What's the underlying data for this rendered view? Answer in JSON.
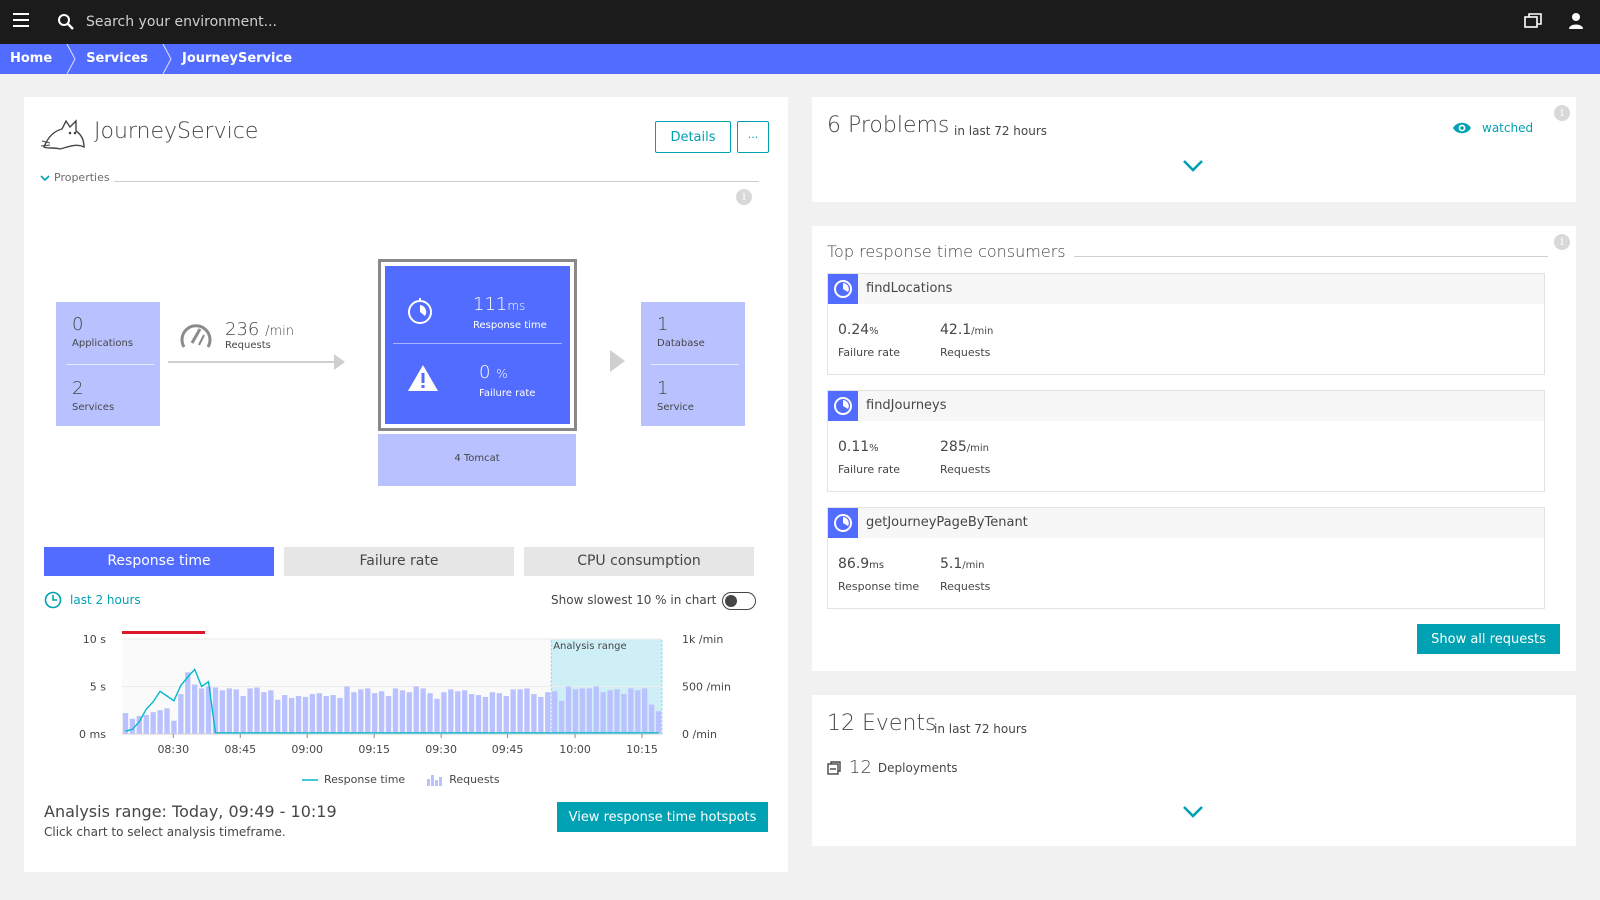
{
  "topbar": {
    "search_placeholder": "Search your environment..."
  },
  "breadcrumb": [
    "Home",
    "Services",
    "JourneyService"
  ],
  "service": {
    "name": "JourneyService",
    "details_label": "Details",
    "more_label": "···",
    "properties_label": "Properties"
  },
  "flow": {
    "callers": {
      "applications_value": "0",
      "applications_label": "Applications",
      "services_value": "2",
      "services_label": "Services"
    },
    "requests": {
      "value": "236",
      "unit": "/min",
      "label": "Requests"
    },
    "main": {
      "response_value": "111",
      "response_unit": "ms",
      "response_label": "Response time",
      "failure_value": "0",
      "failure_unit": "%",
      "failure_label": "Failure rate",
      "process_label": "4 Tomcat"
    },
    "callees": {
      "database_value": "1",
      "database_label": "Database",
      "service_value": "1",
      "service_label": "Service"
    }
  },
  "tabs": [
    "Response time",
    "Failure rate",
    "CPU consumption"
  ],
  "timeframe_label": "last 2 hours",
  "slowest_label": "Show slowest 10 % in chart",
  "chart_data": {
    "type": "bar",
    "x_ticks": [
      "08:30",
      "08:45",
      "09:00",
      "09:15",
      "09:30",
      "09:45",
      "10:00",
      "10:15"
    ],
    "y_left_ticks": [
      "10 s",
      "5 s",
      "0 ms"
    ],
    "y_right_ticks": [
      "1k /min",
      "500 /min",
      "0 /min"
    ],
    "analysis_range_label": "Analysis range",
    "ylim_left_s": [
      0,
      10
    ],
    "ylim_right_per_min": [
      0,
      1000
    ],
    "series": [
      {
        "name": "Requests",
        "values": [
          220,
          160,
          190,
          200,
          230,
          250,
          270,
          140,
          420,
          650,
          520,
          480,
          500,
          490,
          460,
          480,
          470,
          400,
          480,
          490,
          440,
          460,
          360,
          410,
          380,
          400,
          390,
          420,
          430,
          400,
          410,
          380,
          500,
          440,
          470,
          480,
          430,
          450,
          400,
          480,
          460,
          440,
          500,
          480,
          430,
          370,
          440,
          470,
          450,
          460,
          420,
          410,
          390,
          440,
          430,
          400,
          470,
          470,
          480,
          420,
          390,
          440,
          450,
          350,
          500,
          470,
          480,
          480,
          500,
          440,
          460,
          470,
          420,
          480,
          460,
          480,
          310,
          240
        ]
      },
      {
        "name": "Response time",
        "values": [
          0.3,
          0.5,
          1.3,
          2.6,
          3.4,
          4.5,
          4.0,
          3.5,
          5.1,
          6.0,
          6.8,
          5.0,
          5.5,
          0.1,
          0.1,
          0.1,
          0.1,
          0.1,
          0.1,
          0.1,
          0.1,
          0.1,
          0.1,
          0.1,
          0.1,
          0.1,
          0.1,
          0.1,
          0.1,
          0.1,
          0.1,
          0.1,
          0.1,
          0.1,
          0.1,
          0.1,
          0.1,
          0.1,
          0.1,
          0.1,
          0.1,
          0.1,
          0.1,
          0.1,
          0.1,
          0.1,
          0.1,
          0.1,
          0.1,
          0.1,
          0.1,
          0.1,
          0.1,
          0.1,
          0.1,
          0.1,
          0.1,
          0.1,
          0.1,
          0.1,
          0.1,
          0.1,
          0.1,
          0.1,
          0.1,
          0.1,
          0.1,
          0.1,
          0.1,
          0.1,
          0.1,
          0.1,
          0.1,
          0.1,
          0.1,
          0.1,
          0.1,
          0.1
        ]
      }
    ],
    "analysis_start_index": 62,
    "analysis_end_index": 78,
    "alert_start_index": 0,
    "alert_end_index": 12,
    "colors": {
      "bars": "#b9c2ff",
      "line": "#00b9cc",
      "alert": "#dc172a",
      "range": "#cfeff7"
    }
  },
  "legend": {
    "response_time": "Response time",
    "requests": "Requests"
  },
  "analysis": {
    "title": "Analysis range: Today, 09:49 - 10:19",
    "subtitle": "Click chart to select analysis timeframe.",
    "hotspots_button": "View response time hotspots"
  },
  "problems": {
    "count_label": "6 Problems",
    "range_label": "in last 72 hours",
    "watched_label": "watched"
  },
  "consumers": {
    "title": "Top response time consumers",
    "items": [
      {
        "name": "findLocations",
        "m1_value": "0.24",
        "m1_unit": "%",
        "m1_label": "Failure rate",
        "m2_value": "42.1",
        "m2_unit": "/min",
        "m2_label": "Requests"
      },
      {
        "name": "findJourneys",
        "m1_value": "0.11",
        "m1_unit": "%",
        "m1_label": "Failure rate",
        "m2_value": "285",
        "m2_unit": "/min",
        "m2_label": "Requests"
      },
      {
        "name": "getJourneyPageByTenant",
        "m1_value": "86.9",
        "m1_unit": "ms",
        "m1_label": "Response time",
        "m2_value": "5.1",
        "m2_unit": "/min",
        "m2_label": "Requests"
      }
    ],
    "show_all_button": "Show all requests"
  },
  "events": {
    "count_label": "12 Events",
    "range_label": "in last 72 hours",
    "deploy_count": "12",
    "deploy_label": "Deployments"
  },
  "colors": {
    "accent": "#526cff",
    "teal": "#00a1b2",
    "tile": "#b9c2ff"
  }
}
